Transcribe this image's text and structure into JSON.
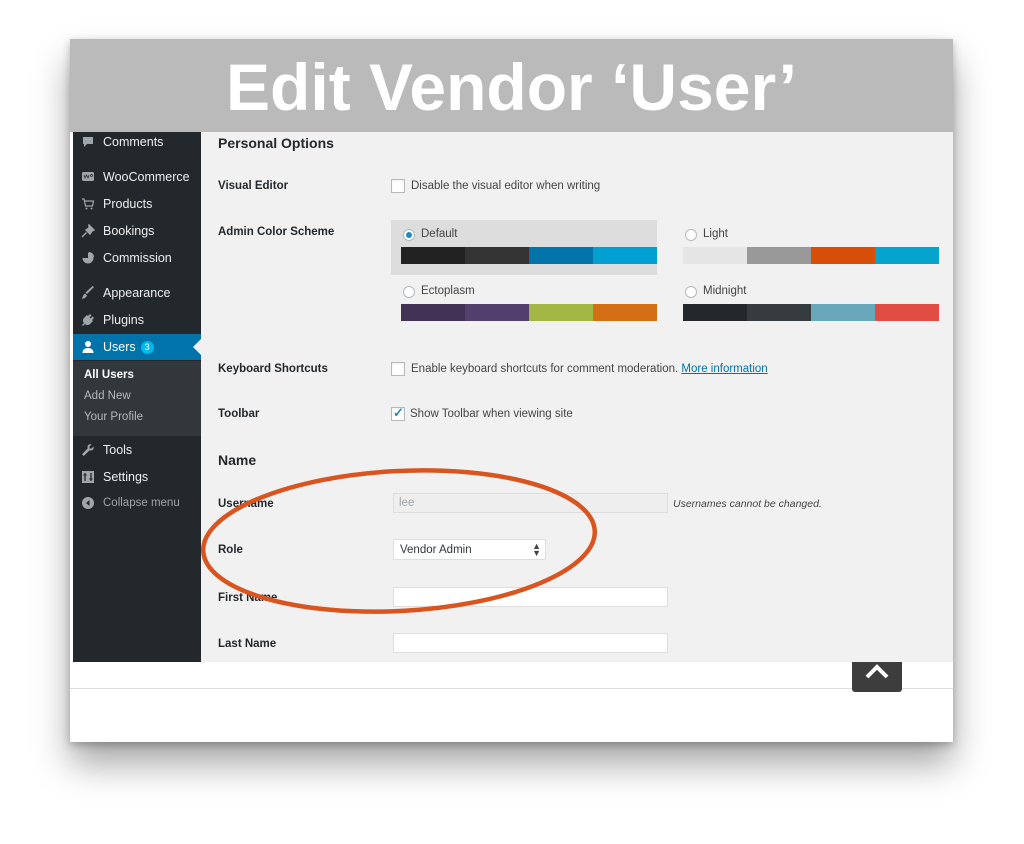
{
  "title": "Edit Vendor ‘User’",
  "sidebar": {
    "items": [
      {
        "label": "Comments",
        "icon": "comment-icon"
      },
      {
        "label": "WooCommerce",
        "icon": "woocommerce-icon"
      },
      {
        "label": "Products",
        "icon": "cart-icon"
      },
      {
        "label": "Bookings",
        "icon": "pin-icon"
      },
      {
        "label": "Commission",
        "icon": "pie-chart-icon"
      },
      {
        "label": "Appearance",
        "icon": "paintbrush-icon"
      },
      {
        "label": "Plugins",
        "icon": "plug-icon"
      },
      {
        "label": "Users",
        "icon": "user-icon",
        "badge": "3"
      },
      {
        "label": "Tools",
        "icon": "wrench-icon"
      },
      {
        "label": "Settings",
        "icon": "settings-icon"
      }
    ],
    "submenu": [
      "All Users",
      "Add New",
      "Your Profile"
    ],
    "collapse_label": "Collapse menu"
  },
  "personal_options": {
    "heading": "Personal Options",
    "visual_editor": {
      "label": "Visual Editor",
      "checkbox_label": "Disable the visual editor when writing",
      "checked": false
    },
    "color_scheme": {
      "label": "Admin Color Scheme",
      "options": [
        {
          "name": "Default",
          "selected": true,
          "colors": [
            "#222222",
            "#333333",
            "#0073aa",
            "#00a0d2"
          ]
        },
        {
          "name": "Light",
          "selected": false,
          "colors": [
            "#e5e5e5",
            "#999999",
            "#d64e07",
            "#04a4cc"
          ]
        },
        {
          "name": "Ectoplasm",
          "selected": false,
          "colors": [
            "#413256",
            "#523f6d",
            "#a3b745",
            "#d46f15"
          ]
        },
        {
          "name": "Midnight",
          "selected": false,
          "colors": [
            "#25282b",
            "#363b3f",
            "#69a8bb",
            "#e14d43"
          ]
        }
      ]
    },
    "keyboard_shortcuts": {
      "label": "Keyboard Shortcuts",
      "checkbox_label": "Enable keyboard shortcuts for comment moderation.",
      "link": "More information",
      "checked": false
    },
    "toolbar": {
      "label": "Toolbar",
      "checkbox_label": "Show Toolbar when viewing site",
      "checked": true
    }
  },
  "name_section": {
    "heading": "Name",
    "username": {
      "label": "Username",
      "value": "lee",
      "description": "Usernames cannot be changed."
    },
    "role": {
      "label": "Role",
      "value": "Vendor Admin"
    },
    "first_name": {
      "label": "First Name",
      "value": ""
    },
    "last_name": {
      "label": "Last Name",
      "value": ""
    }
  },
  "colors": {
    "annotation": "#d9541e",
    "admin_blue": "#0073aa",
    "sidebar_bg": "#23282d"
  }
}
